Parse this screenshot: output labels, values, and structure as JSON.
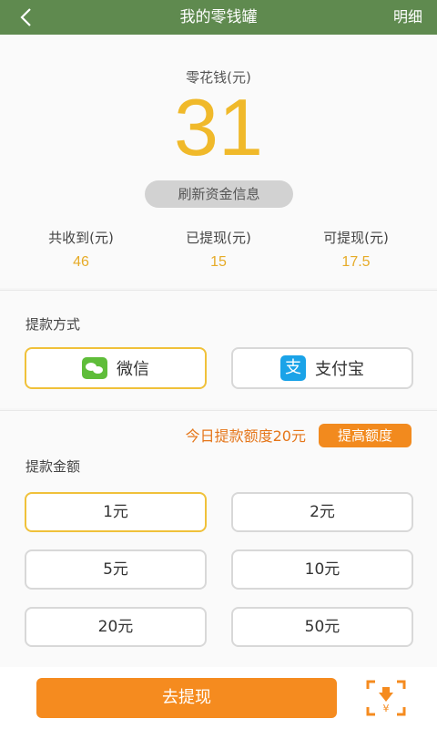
{
  "header": {
    "title": "我的零钱罐",
    "detail_label": "明细"
  },
  "summary": {
    "pocket_label": "零花钱(元)",
    "pocket_value": "31",
    "refresh_label": "刷新资金信息",
    "stats": [
      {
        "label": "共收到(元)",
        "value": "46"
      },
      {
        "label": "已提现(元)",
        "value": "15"
      },
      {
        "label": "可提现(元)",
        "value": "17.5"
      }
    ]
  },
  "method": {
    "title": "提款方式",
    "options": [
      {
        "label": "微信",
        "icon": "wechat-icon",
        "selected": true
      },
      {
        "label": "支付宝",
        "icon": "alipay-icon",
        "selected": false
      }
    ],
    "alipay_glyph": "支"
  },
  "amount": {
    "limit_text": "今日提款额度20元",
    "raise_label": "提高额度",
    "title": "提款金额",
    "options": [
      "1元",
      "2元",
      "5元",
      "10元",
      "20元",
      "50元"
    ],
    "selected_index": 0
  },
  "bottom": {
    "withdraw_label": "去提现",
    "scan_icon": "yuan-scan-icon",
    "scan_glyph": "¥"
  },
  "colors": {
    "header_bg": "#5f8a4f",
    "accent_yellow": "#f0b92a",
    "accent_orange": "#f58b1f"
  }
}
